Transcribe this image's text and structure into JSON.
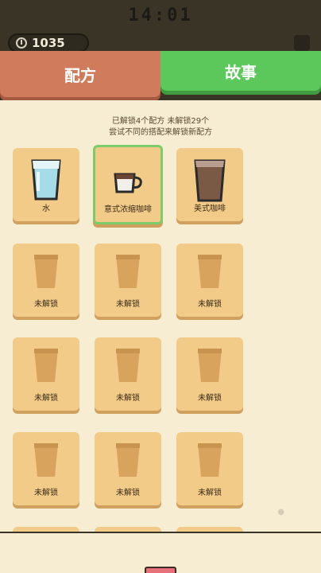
{
  "status": {
    "time": "14:01"
  },
  "topbar": {
    "coins": "1035",
    "coin_icon": "coin-icon",
    "puzzle_icon": "puzzle-icon"
  },
  "tabs": [
    {
      "label": "配方",
      "color": "#d07c5c",
      "active": true
    },
    {
      "label": "故事",
      "color": "#5cc85c",
      "active": false
    }
  ],
  "info": {
    "line1": "已解锁4个配方 未解锁29个",
    "line2": "尝试不同的搭配来解锁新配方"
  },
  "recipes": [
    {
      "label": "水",
      "icon": "water-glass-icon",
      "unlocked": true,
      "selected": false
    },
    {
      "label": "意式浓缩咖啡",
      "icon": "espresso-cup-icon",
      "unlocked": true,
      "selected": true
    },
    {
      "label": "美式咖啡",
      "icon": "americano-glass-icon",
      "unlocked": true,
      "selected": false
    },
    {
      "label": "未解锁",
      "icon": "locked-cup-icon",
      "unlocked": false
    },
    {
      "label": "未解锁",
      "icon": "locked-cup-icon",
      "unlocked": false
    },
    {
      "label": "未解锁",
      "icon": "locked-cup-icon",
      "unlocked": false
    },
    {
      "label": "未解锁",
      "icon": "locked-cup-icon",
      "unlocked": false
    },
    {
      "label": "未解锁",
      "icon": "locked-cup-icon",
      "unlocked": false
    },
    {
      "label": "未解锁",
      "icon": "locked-cup-icon",
      "unlocked": false
    },
    {
      "label": "未解锁",
      "icon": "locked-cup-icon",
      "unlocked": false
    },
    {
      "label": "未解锁",
      "icon": "locked-cup-icon",
      "unlocked": false
    },
    {
      "label": "未解锁",
      "icon": "locked-cup-icon",
      "unlocked": false
    }
  ],
  "colors": {
    "card": "#f3cb88",
    "selected_border": "#7ccc6a",
    "background": "#f6edd3"
  }
}
